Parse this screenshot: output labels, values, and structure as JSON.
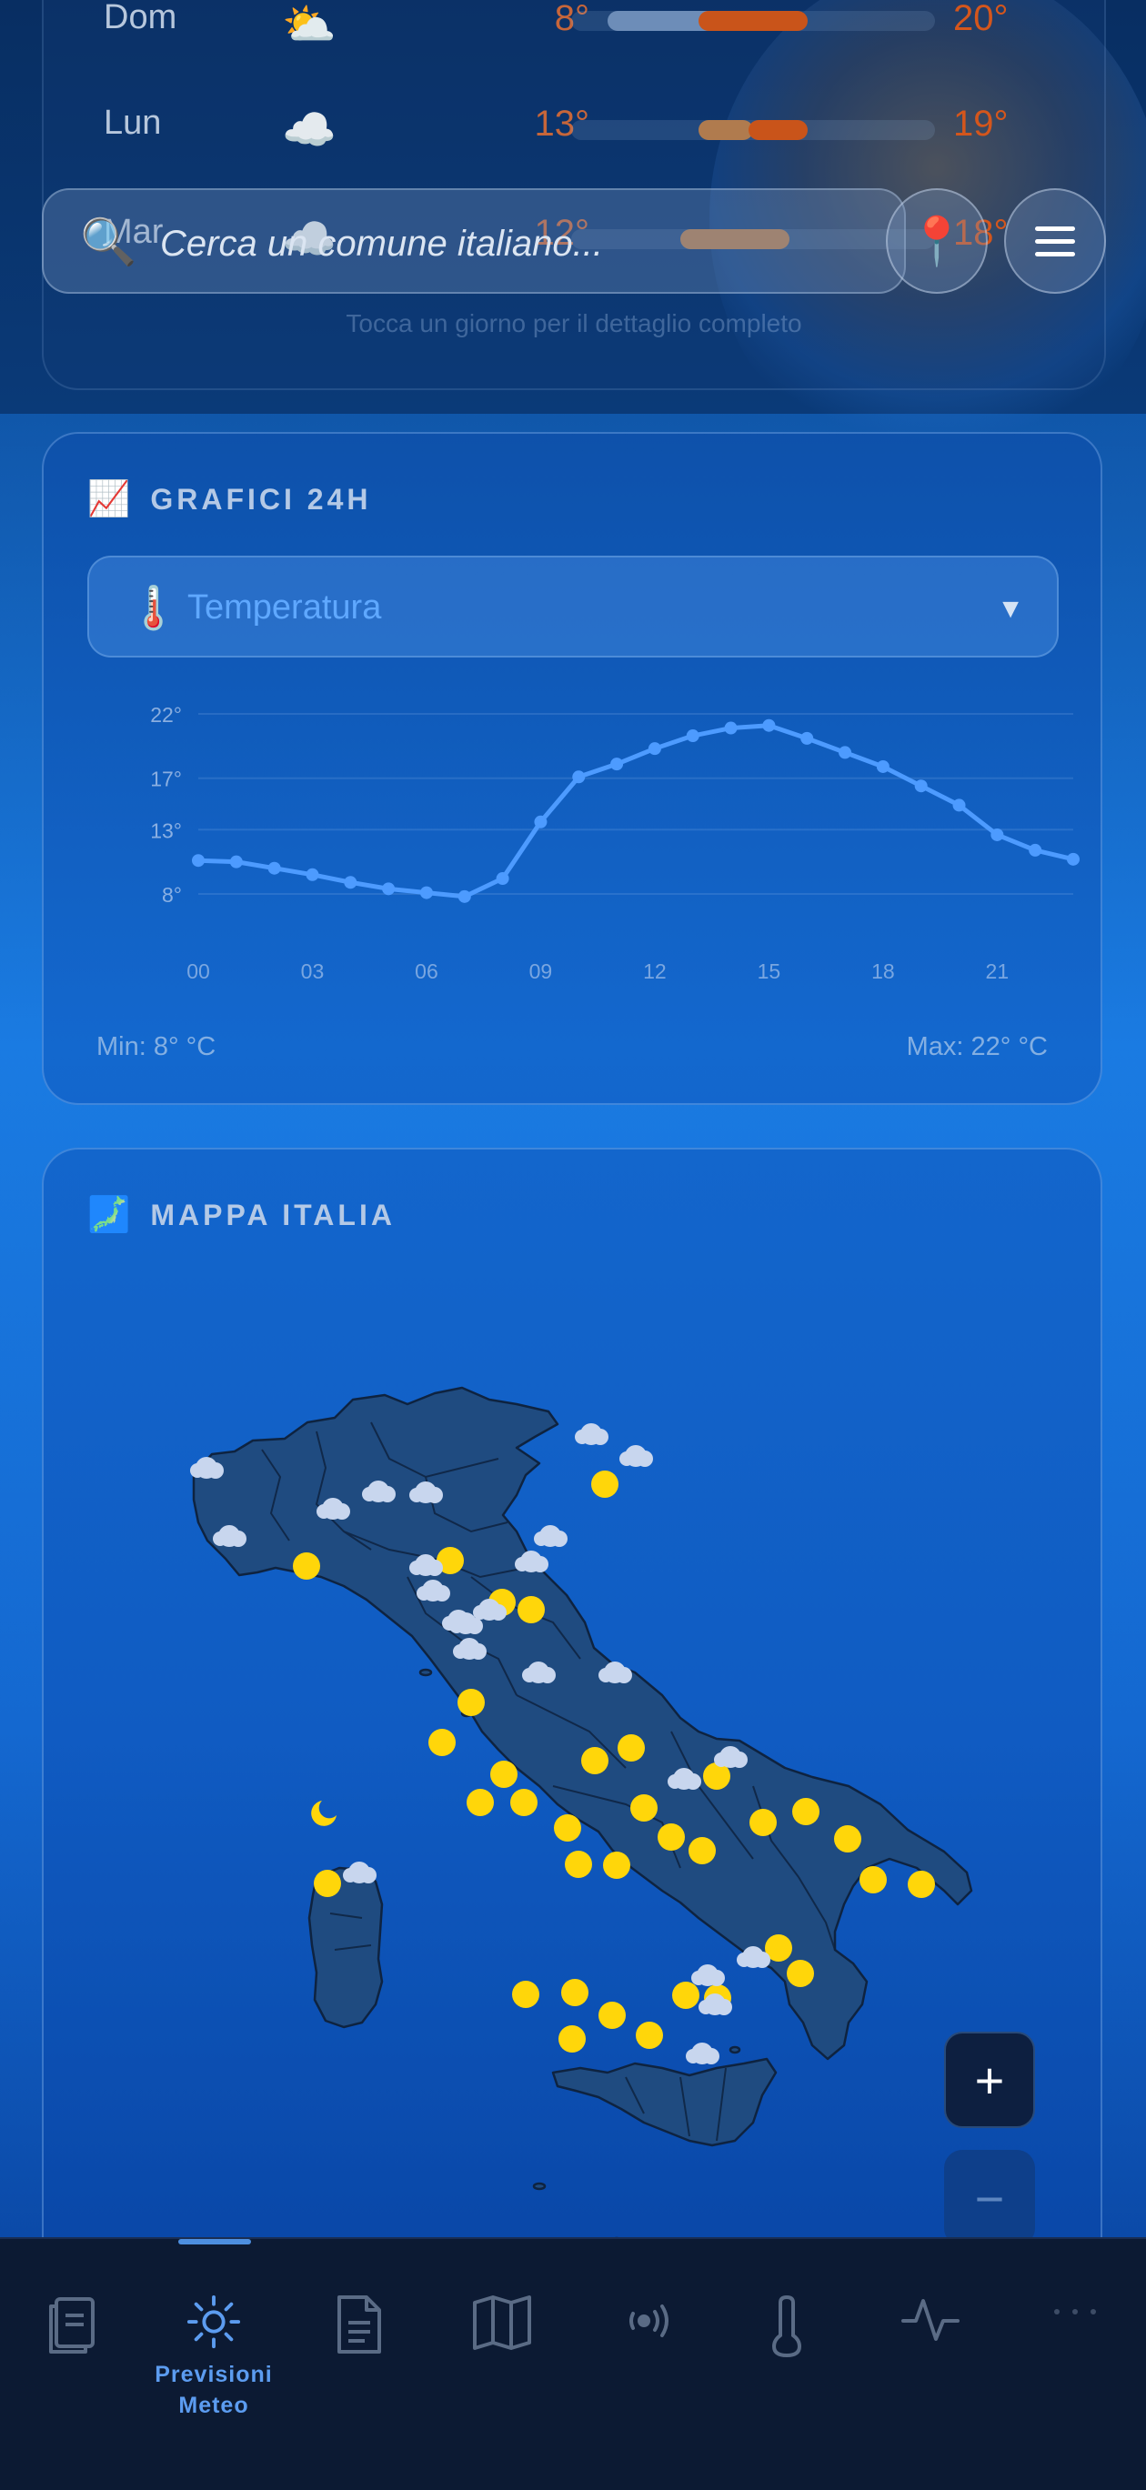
{
  "forecast_week": {
    "days": [
      {
        "day": "Dom",
        "icon": "⛅",
        "min": "8°",
        "max": "20°"
      },
      {
        "day": "Lun",
        "icon": "☁️",
        "min": "13°",
        "max": "19°"
      },
      {
        "day": "Mar",
        "icon": "☁️",
        "min": "12°",
        "max": "18°"
      }
    ],
    "hint": "Tocca un giorno per il dettaglio completo"
  },
  "search": {
    "placeholder": "Cerca un comune italiano...",
    "icon": "magnifier-icon",
    "location_icon": "pin-icon",
    "menu_icon": "hamburger-menu-icon"
  },
  "charts_card": {
    "emoji": "📈",
    "title": "GRAFICI 24H",
    "selector": {
      "icon": "🌡️",
      "selected": "Temperatura"
    },
    "min_label": "Min: 8° °C",
    "max_label": "Max: 22° °C"
  },
  "chart_data": {
    "type": "line",
    "x": [
      0,
      1,
      2,
      3,
      4,
      5,
      6,
      7,
      8,
      9,
      10,
      11,
      12,
      13,
      14,
      15,
      16,
      17,
      18,
      19,
      20,
      21,
      22,
      23
    ],
    "values": [
      10.6,
      10.5,
      10.0,
      9.5,
      8.9,
      8.4,
      8.1,
      7.8,
      9.2,
      13.6,
      17.1,
      18.1,
      19.3,
      20.3,
      20.9,
      21.1,
      20.1,
      19.0,
      17.9,
      16.4,
      14.9,
      12.6,
      11.4,
      10.7
    ],
    "xtick_labels": [
      "00",
      "03",
      "06",
      "09",
      "12",
      "15",
      "18",
      "21"
    ],
    "yticks": [
      8,
      13,
      17,
      22
    ],
    "ytick_labels": [
      "8°",
      "13°",
      "17°",
      "22°"
    ],
    "ylim": [
      8,
      22
    ],
    "grid": true,
    "color": "#4d9bff"
  },
  "map_card": {
    "emoji": "🗾",
    "title": "MAPPA ITALIA",
    "zoom_in": "+",
    "zoom_out": "−"
  },
  "nav": {
    "items": [
      {
        "icon": "notebook-icon"
      },
      {
        "icon": "sun-icon",
        "label_line1": "Previsioni",
        "label_line2": "Meteo",
        "active": true
      },
      {
        "icon": "document-icon"
      },
      {
        "icon": "map-icon"
      },
      {
        "icon": "radar-icon"
      },
      {
        "icon": "thermometer-icon"
      },
      {
        "icon": "activity-icon"
      },
      {
        "icon": "more-icon"
      }
    ]
  },
  "colors": {
    "accent": "#4d9bff",
    "sun": "#ffd60a",
    "map_land": "#1d4a80",
    "nav_bg": "#0c1a33"
  }
}
